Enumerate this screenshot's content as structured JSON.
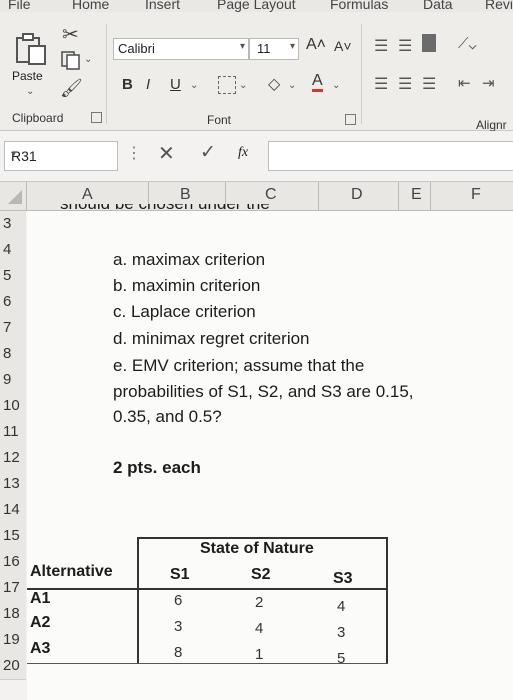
{
  "ribbon": {
    "tabs": [
      "File",
      "Home",
      "Insert",
      "Page Layout",
      "Formulas",
      "Data",
      "Revi"
    ],
    "clipboard": {
      "paste_label": "Paste",
      "group_label": "Clipboard"
    },
    "font": {
      "name": "Calibri",
      "size": "11",
      "bold": "B",
      "italic": "I",
      "underline": "U",
      "group_label": "Font"
    },
    "alignment": {
      "group_label": "Alignr"
    }
  },
  "formula_bar": {
    "name_box": "R31",
    "fx": "fx",
    "content": ""
  },
  "columns": [
    "A",
    "B",
    "C",
    "D",
    "E",
    "F"
  ],
  "rows": [
    "3",
    "4",
    "5",
    "6",
    "7",
    "8",
    "9",
    "10",
    "11",
    "12",
    "13",
    "14",
    "15",
    "16",
    "17",
    "18",
    "19",
    "20"
  ],
  "content": {
    "clipped_top": "should be chosen under the",
    "items": [
      "a. maximax criterion",
      "b. maximin criterion",
      "c. Laplace criterion",
      "d. minimax regret criterion",
      "e. EMV criterion; assume that the",
      "probabilities of S1, S2, and S3 are 0.15,",
      "0.35, and 0.5?"
    ],
    "points": "2 pts. each"
  },
  "payoff_table": {
    "header": "State of Nature",
    "alt_label": "Alternative",
    "states": [
      "S1",
      "S2",
      "S3"
    ],
    "rows": [
      {
        "alt": "A1",
        "values": [
          "6",
          "2",
          "4"
        ]
      },
      {
        "alt": "A2",
        "values": [
          "3",
          "4",
          "3"
        ]
      },
      {
        "alt": "A3",
        "values": [
          "8",
          "1",
          "5"
        ]
      }
    ]
  }
}
